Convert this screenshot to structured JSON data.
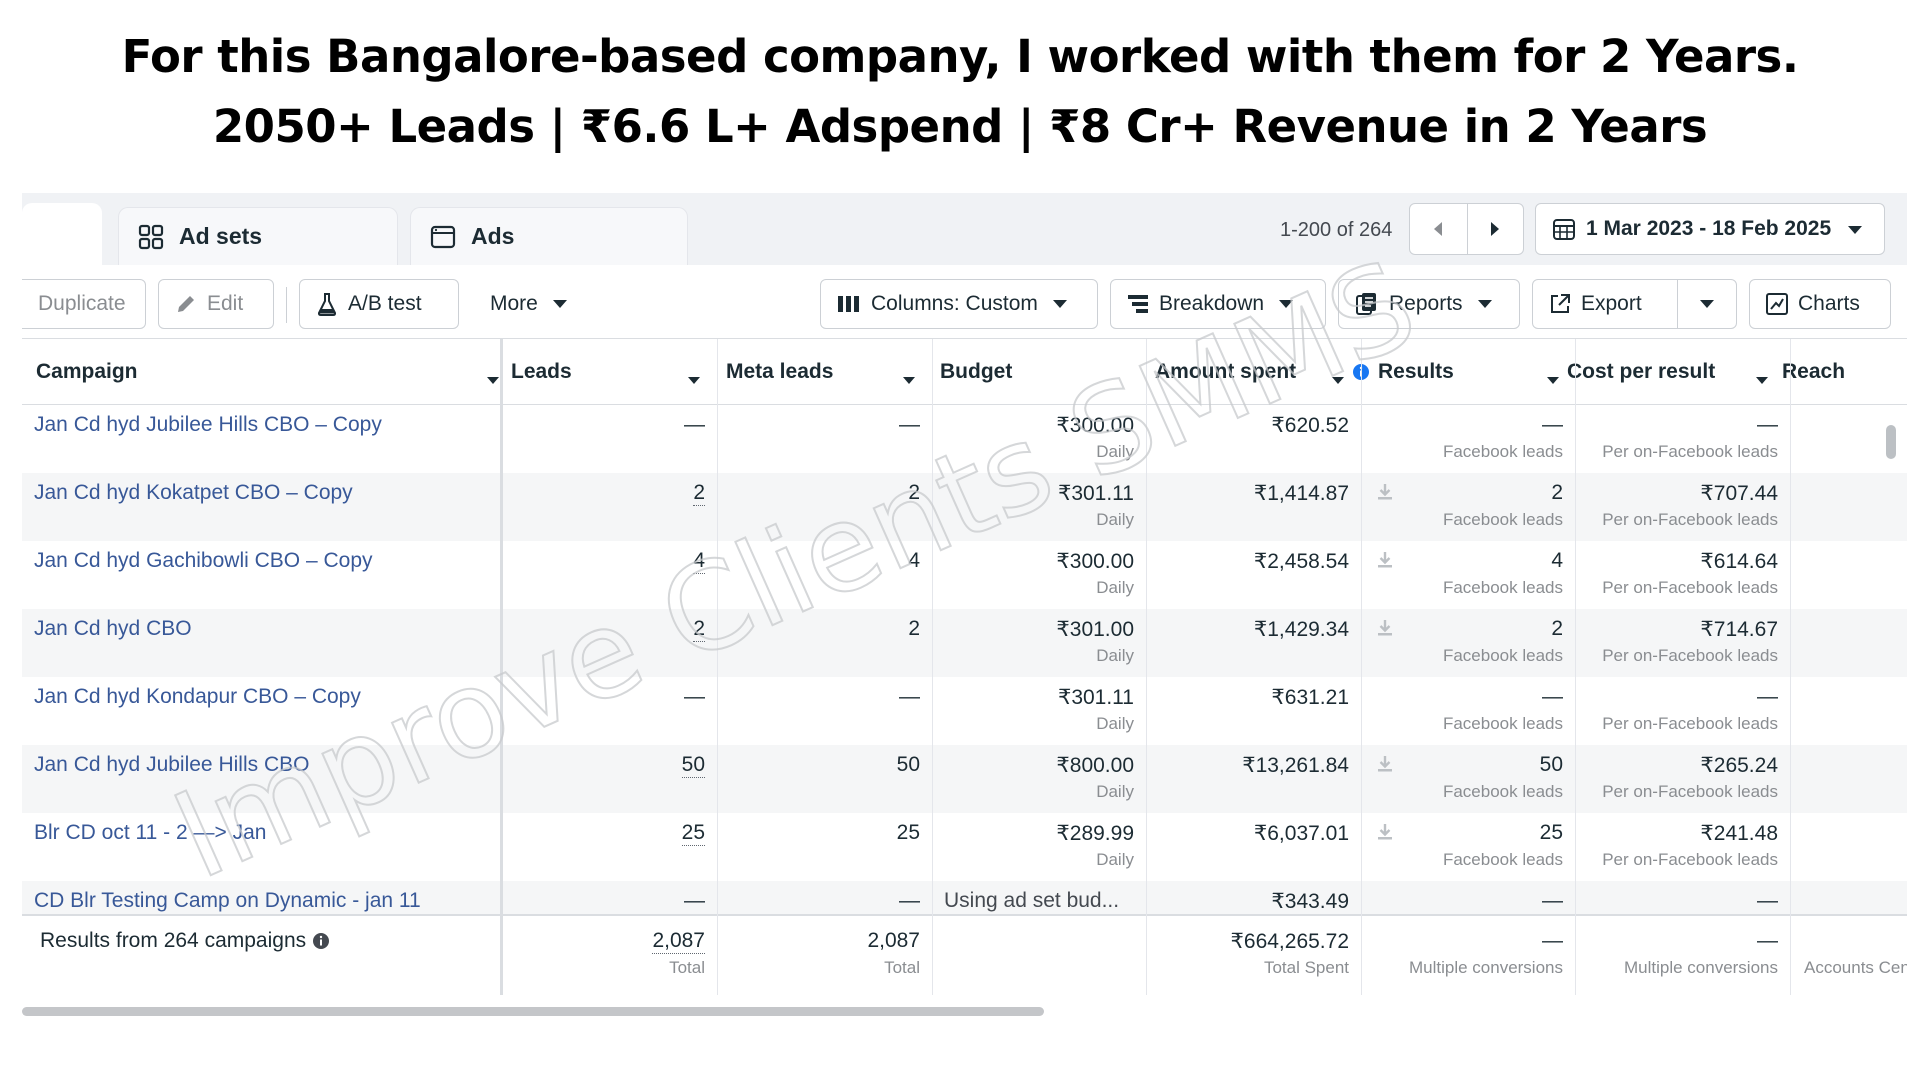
{
  "headline": {
    "line1": "For this Bangalore-based company, I worked with them for 2 Years.",
    "line2": "2050+ Leads | ₹6.6 L+ Adspend | ₹8 Cr+ Revenue in 2 Years"
  },
  "tabs": [
    {
      "label": "Ad sets",
      "icon": "grid-icon"
    },
    {
      "label": "Ads",
      "icon": "ad-window-icon"
    }
  ],
  "pager": {
    "count": "1-200 of 264"
  },
  "date_range": "1 Mar 2023 - 18 Feb 2025",
  "toolbar": {
    "duplicate": "Duplicate",
    "edit": "Edit",
    "ab_test": "A/B test",
    "more": "More",
    "columns": "Columns: Custom",
    "breakdown": "Breakdown",
    "reports": "Reports",
    "export": "Export",
    "charts": "Charts"
  },
  "columns": [
    "Campaign",
    "Leads",
    "Meta leads",
    "Budget",
    "Amount spent",
    "Results",
    "Cost per result",
    "Reach"
  ],
  "rows": [
    {
      "name": "Jan Cd hyd Jubilee Hills CBO – Copy",
      "leads": "—",
      "meta_leads": "—",
      "budget": "₹300.00",
      "budget_sub": "Daily",
      "spent": "₹620.52",
      "results": "—",
      "results_sub": "Facebook leads",
      "cpr": "—",
      "cpr_sub": "Per on-Facebook leads",
      "download": false
    },
    {
      "name": "Jan Cd hyd Kokatpet CBO – Copy",
      "leads": "2",
      "meta_leads": "2",
      "budget": "₹301.11",
      "budget_sub": "Daily",
      "spent": "₹1,414.87",
      "results": "2",
      "results_sub": "Facebook leads",
      "cpr": "₹707.44",
      "cpr_sub": "Per on-Facebook leads",
      "download": true
    },
    {
      "name": "Jan Cd hyd Gachibowli CBO – Copy",
      "leads": "4",
      "meta_leads": "4",
      "budget": "₹300.00",
      "budget_sub": "Daily",
      "spent": "₹2,458.54",
      "results": "4",
      "results_sub": "Facebook leads",
      "cpr": "₹614.64",
      "cpr_sub": "Per on-Facebook leads",
      "download": true
    },
    {
      "name": "Jan Cd hyd CBO",
      "leads": "2",
      "meta_leads": "2",
      "budget": "₹301.00",
      "budget_sub": "Daily",
      "spent": "₹1,429.34",
      "results": "2",
      "results_sub": "Facebook leads",
      "cpr": "₹714.67",
      "cpr_sub": "Per on-Facebook leads",
      "download": true
    },
    {
      "name": "Jan Cd hyd Kondapur CBO – Copy",
      "leads": "—",
      "meta_leads": "—",
      "budget": "₹301.11",
      "budget_sub": "Daily",
      "spent": "₹631.21",
      "results": "—",
      "results_sub": "Facebook leads",
      "cpr": "—",
      "cpr_sub": "Per on-Facebook leads",
      "download": false
    },
    {
      "name": "Jan Cd hyd Jubilee Hills CBO",
      "leads": "50",
      "meta_leads": "50",
      "budget": "₹800.00",
      "budget_sub": "Daily",
      "spent": "₹13,261.84",
      "results": "50",
      "results_sub": "Facebook leads",
      "cpr": "₹265.24",
      "cpr_sub": "Per on-Facebook leads",
      "download": true
    },
    {
      "name": "Blr CD oct 11 - 2 —> Jan",
      "leads": "25",
      "meta_leads": "25",
      "budget": "₹289.99",
      "budget_sub": "Daily",
      "spent": "₹6,037.01",
      "results": "25",
      "results_sub": "Facebook leads",
      "cpr": "₹241.48",
      "cpr_sub": "Per on-Facebook leads",
      "download": true
    },
    {
      "name": "CD Blr Testing Camp on Dynamic - jan 11",
      "leads": "—",
      "meta_leads": "—",
      "budget": "Using ad set bud...",
      "budget_sub": "",
      "spent": "₹343.49",
      "results": "—",
      "results_sub": "",
      "cpr": "—",
      "cpr_sub": "",
      "download": false
    }
  ],
  "totals": {
    "label": "Results from 264 campaigns",
    "leads": "2,087",
    "leads_sub": "Total",
    "meta_leads": "2,087",
    "meta_leads_sub": "Total",
    "spent": "₹664,265.72",
    "spent_sub": "Total Spent",
    "results": "—",
    "results_sub": "Multiple conversions",
    "cpr": "—",
    "cpr_sub": "Multiple conversions",
    "reach_sub": "Accounts Centr"
  },
  "watermark": "Improve Clients SMMS",
  "colors": {
    "link": "#385898",
    "muted": "#8a8d91",
    "text": "#1c2b33"
  }
}
